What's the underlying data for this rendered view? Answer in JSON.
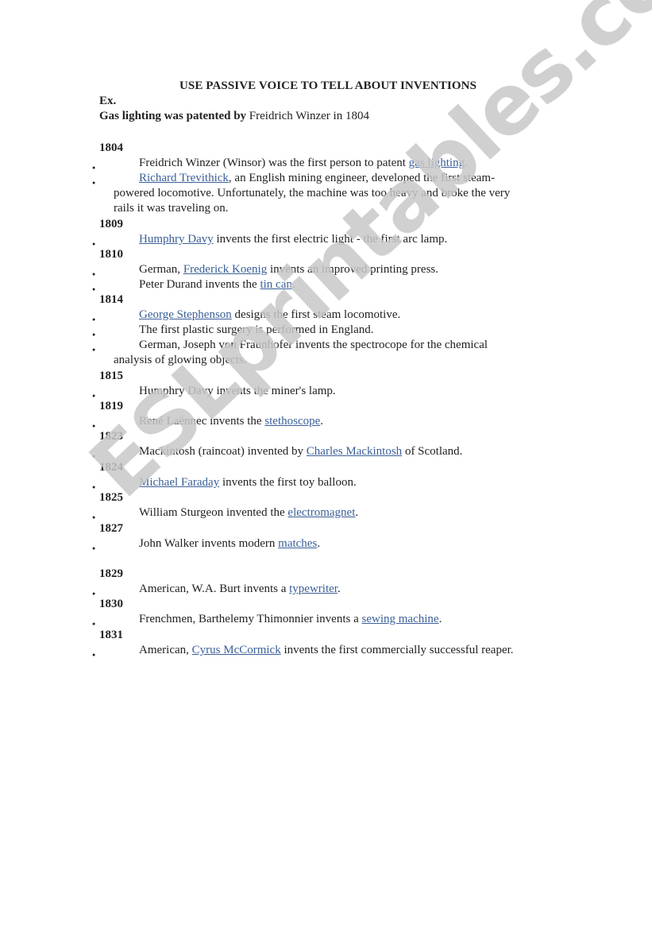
{
  "document": {
    "title": "USE PASSIVE VOICE TO TELL ABOUT INVENTIONS",
    "example_label": "Ex.",
    "example_bold": "Gas lighting was patented by",
    "example_rest": " Freidrich Winzer in 1804",
    "watermark": "ESLprintables.com",
    "colors": {
      "link": "#3b5f98",
      "text": "#222222",
      "watermark": "#c8c8c8"
    }
  },
  "sections": [
    {
      "year": "1804",
      "items": [
        {
          "parts": [
            {
              "t": "Freidrich Winzer (Winsor) was the first person to patent "
            },
            {
              "t": "gas lighting",
              "link": true
            },
            {
              "t": "."
            }
          ]
        },
        {
          "parts": [
            {
              "t": "Richard Trevithick",
              "link": true
            },
            {
              "t": ", an English mining engineer, developed the first steam-"
            }
          ],
          "continuation": [
            "powered locomotive. Unfortunately, the machine was too heavy and broke the very",
            "rails it was traveling on."
          ]
        }
      ]
    },
    {
      "year": "1809",
      "items": [
        {
          "parts": [
            {
              "t": "Humphry Davy",
              "link": true
            },
            {
              "t": " invents the first electric light - the first arc lamp."
            }
          ]
        }
      ]
    },
    {
      "year": "1810",
      "items": [
        {
          "parts": [
            {
              "t": "German, "
            },
            {
              "t": "Frederick Koenig",
              "link": true
            },
            {
              "t": " invents an improved printing press."
            }
          ]
        },
        {
          "parts": [
            {
              "t": "Peter Durand invents the "
            },
            {
              "t": "tin can",
              "link": true
            },
            {
              "t": "."
            }
          ]
        }
      ]
    },
    {
      "year": "1814",
      "items": [
        {
          "parts": [
            {
              "t": "George Stephenson",
              "link": true
            },
            {
              "t": " designs the first steam locomotive."
            }
          ]
        },
        {
          "parts": [
            {
              "t": "The first plastic surgery is performed in England."
            }
          ]
        },
        {
          "parts": [
            {
              "t": "German, Joseph von Fraunhofer invents the spectrocope for the chemical"
            }
          ],
          "continuation": [
            "analysis of glowing objects."
          ]
        }
      ]
    },
    {
      "year": "1815",
      "items": [
        {
          "parts": [
            {
              "t": "Humphry Davy invents the miner's lamp."
            }
          ]
        }
      ]
    },
    {
      "year": "1819",
      "items": [
        {
          "parts": [
            {
              "t": "René Laënnec invents the "
            },
            {
              "t": "stethoscope",
              "link": true
            },
            {
              "t": "."
            }
          ]
        }
      ]
    },
    {
      "year": "1823",
      "items": [
        {
          "parts": [
            {
              "t": "Mackintosh (raincoat) invented by "
            },
            {
              "t": "Charles Mackintosh",
              "link": true
            },
            {
              "t": " of Scotland."
            }
          ]
        }
      ]
    },
    {
      "year": "1824",
      "items": [
        {
          "parts": [
            {
              "t": "Michael Faraday",
              "link": true
            },
            {
              "t": " invents the first toy balloon."
            }
          ]
        }
      ]
    },
    {
      "year": "1825",
      "items": [
        {
          "parts": [
            {
              "t": "William Sturgeon invented the "
            },
            {
              "t": "electromagnet",
              "link": true
            },
            {
              "t": "."
            }
          ]
        }
      ]
    },
    {
      "year": "1827",
      "items": [
        {
          "parts": [
            {
              "t": "John Walker invents modern "
            },
            {
              "t": "matches",
              "link": true
            },
            {
              "t": "."
            }
          ]
        }
      ]
    },
    {
      "year": "1829",
      "items": [
        {
          "parts": [
            {
              "t": "American, W.A. Burt invents a "
            },
            {
              "t": "typewriter",
              "link": true
            },
            {
              "t": "."
            }
          ]
        }
      ]
    },
    {
      "year": "1830",
      "items": [
        {
          "parts": [
            {
              "t": "Frenchmen, Barthelemy Thimonnier invents a "
            },
            {
              "t": "sewing machine",
              "link": true
            },
            {
              "t": "."
            }
          ]
        }
      ]
    },
    {
      "year": "1831",
      "items": [
        {
          "parts": [
            {
              "t": "American, "
            },
            {
              "t": "Cyrus McCormick",
              "link": true
            },
            {
              "t": " invents the first commercially successful reaper."
            }
          ]
        }
      ]
    }
  ]
}
